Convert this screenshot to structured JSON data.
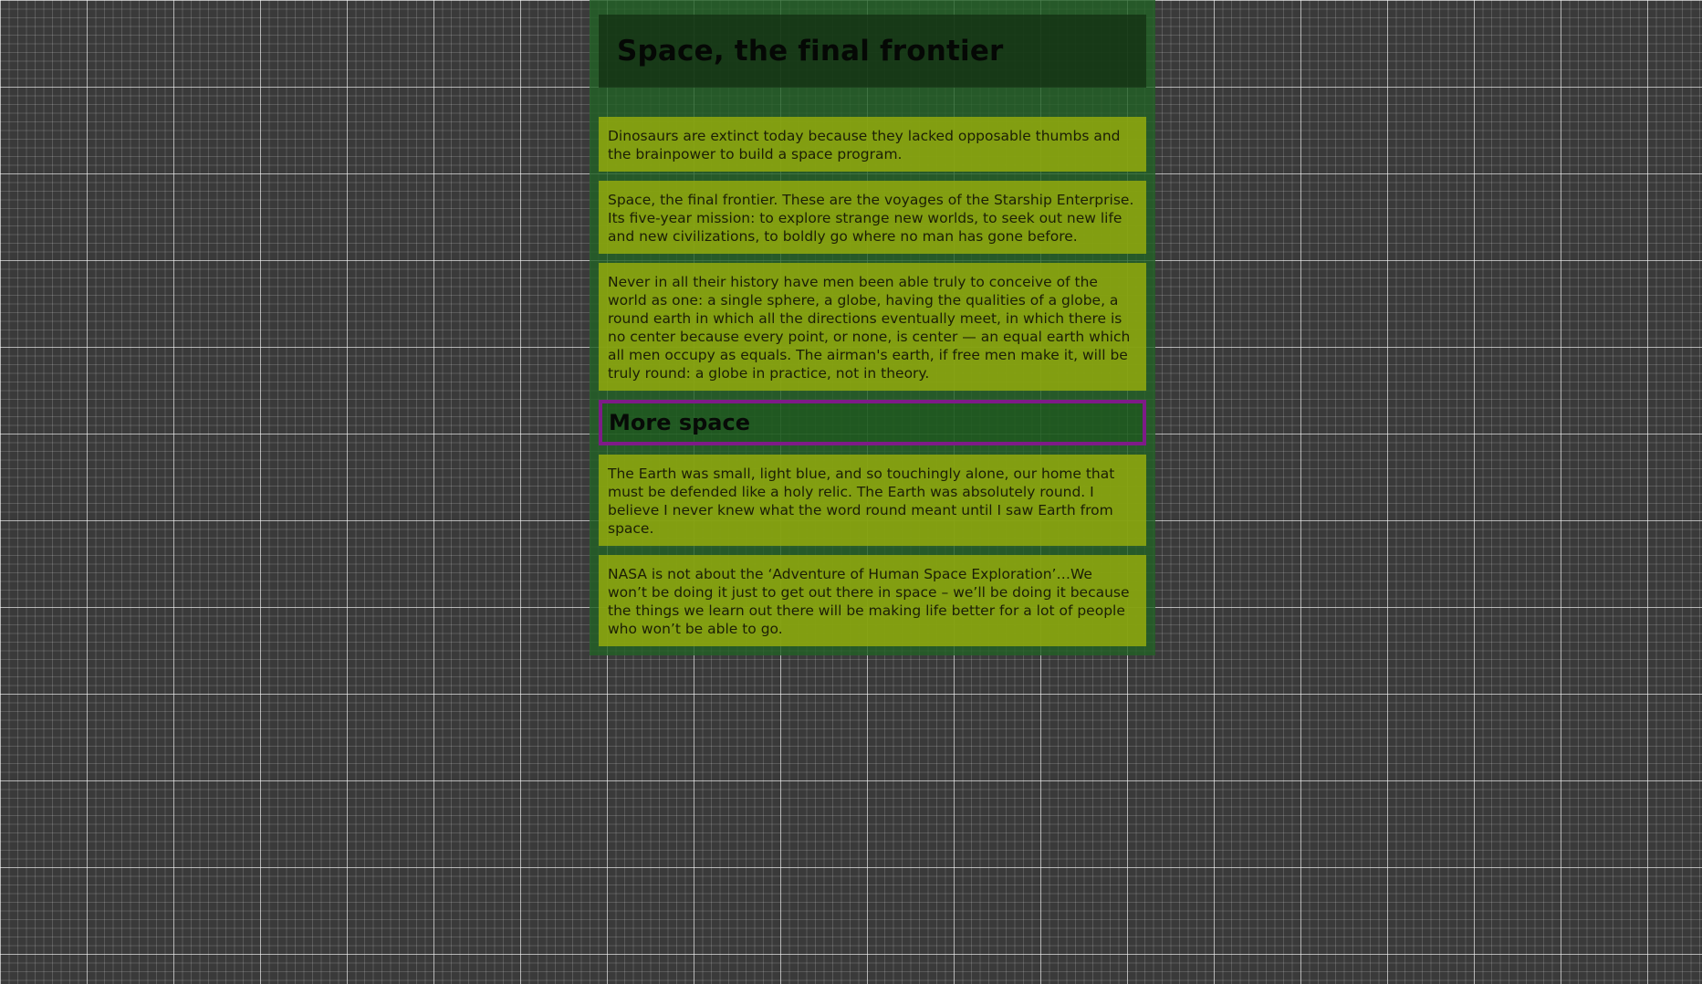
{
  "page": {
    "title": "Space, the final frontier",
    "paragraphs_top": [
      "Dinosaurs are extinct today because they lacked opposable thumbs and the brainpower to build a space program.",
      "Space, the final frontier. These are the voyages of the Starship Enterprise. Its five-year mission: to explore strange new worlds, to seek out new life and new civilizations, to boldly go where no man has gone before.",
      "Never in all their history have men been able truly to conceive of the world as one: a single sphere, a globe, having the qualities of a globe, a round earth in which all the directions eventually meet, in which there is no center because every point, or none, is center — an equal earth which all men occupy as equals. The airman's earth, if free men make it, will be truly round: a globe in practice, not in theory."
    ],
    "subheading": "More space",
    "paragraphs_bottom": [
      "The Earth was small, light blue, and so touchingly alone, our home that must be defended like a holy relic. The Earth was absolutely round. I believe I never knew what the word round meant until I saw Earth from space.",
      "NASA is not about the ‘Adventure of Human Space Exploration’…We won’t be doing it just to get out there in space – we’ll be doing it because the things we learn out there will be making life better for a lot of people who won’t be able to go."
    ]
  },
  "colors": {
    "background": "#3a3a3a",
    "container": "#226226",
    "header": "#122d10",
    "card": "#91aa0e",
    "highlight_border": "#7e1b88"
  }
}
